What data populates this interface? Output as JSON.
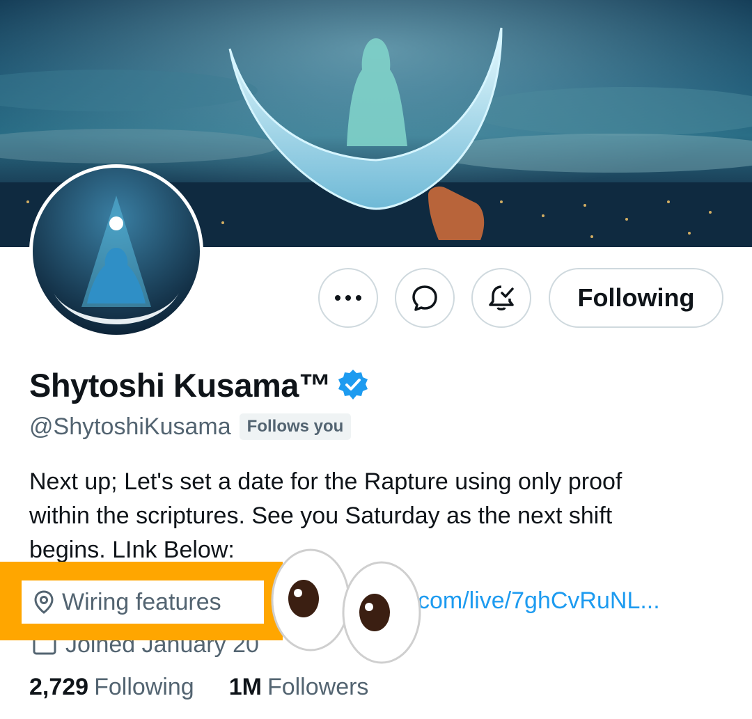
{
  "profile": {
    "name": "Shytoshi Kusama™",
    "handle": "@ShytoshiKusama",
    "follows_you": "Follows you",
    "bio": [
      "Next up; Let's set a date for the Rapture using only proof",
      "within the scriptures. See you Saturday as the next shift",
      "begins.  LInk Below:"
    ],
    "location": "Wiring features",
    "link_visible": "com/live/7ghCvRuNL...",
    "joined": "Joined January 20"
  },
  "actions": {
    "more_icon": "more-horizontal-icon",
    "message_icon": "message-bubble-icon",
    "notify_icon": "bell-check-icon",
    "follow_label": "Following"
  },
  "stats": {
    "following_count": "2,729",
    "following_label": "Following",
    "followers_count": "1M",
    "followers_label": "Followers"
  },
  "colors": {
    "link": "#1d9bf0",
    "secondary_text": "#536471",
    "highlight_outer": "#ffa600",
    "verified": "#1d9bf0"
  }
}
